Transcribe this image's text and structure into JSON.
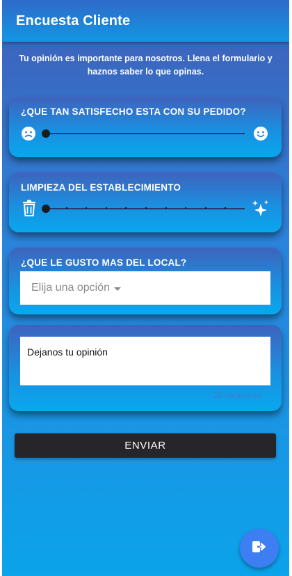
{
  "appbar": {
    "title": "Encuesta Cliente"
  },
  "intro": {
    "text": "Tu opinión es importante para nosotros. Llena el formulario y haznos saber lo que opinas."
  },
  "satisfaction": {
    "label": "¿QUE TAN SATISFECHO ESTA CON SU PEDIDO?",
    "left_icon": "sad-face-icon",
    "right_icon": "happy-face-icon",
    "value": 0
  },
  "cleanliness": {
    "label": "LIMPIEZA DEL ESTABLECIMIENTO",
    "left_icon": "trash-icon",
    "right_icon": "sparkles-icon",
    "value": 0,
    "steps": 10
  },
  "favorite": {
    "label": "¿QUE LE GUSTO MAS DEL LOCAL?",
    "placeholder": "Elija una opción"
  },
  "opinion": {
    "placeholder": "Dejanos tu opinión",
    "counter": "20 caracteres"
  },
  "submit": {
    "label": "ENVIAR"
  },
  "fab": {
    "icon": "sign-out-icon"
  },
  "colors": {
    "accent": "#3d7ef2",
    "button": "#26262a",
    "gradient_top": "#3f5fb8",
    "gradient_bottom": "#0ba3ea"
  }
}
